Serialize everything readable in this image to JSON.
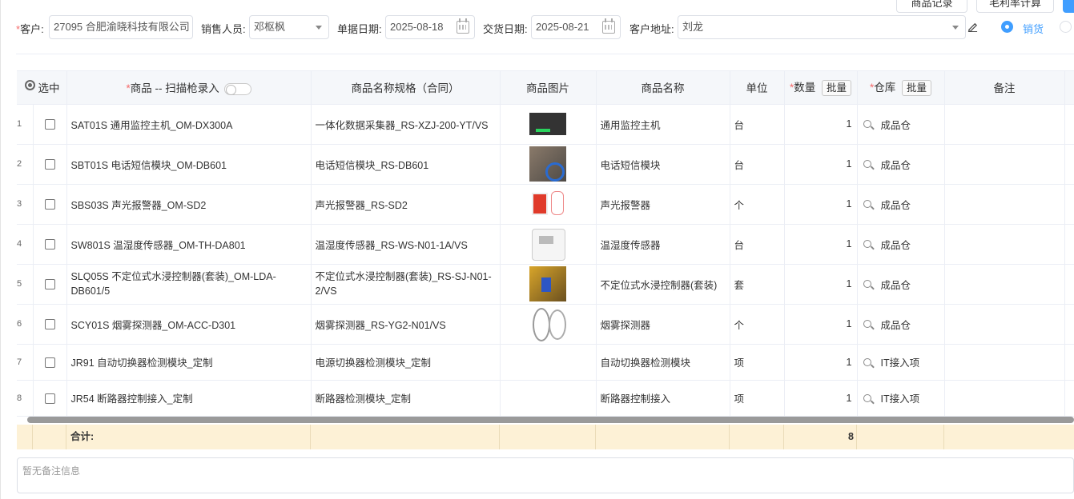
{
  "top_buttons": [
    {
      "label": "商品记录"
    },
    {
      "label": "毛利率计算"
    }
  ],
  "form": {
    "customer_label": "客户:",
    "customer_value": "27095 合肥渝晓科技有限公司",
    "salesperson_label": "销售人员:",
    "salesperson_value": "邓枢枫",
    "doc_date_label": "单据日期:",
    "doc_date_value": "2025-08-18",
    "delivery_date_label": "交货日期:",
    "delivery_date_value": "2025-08-21",
    "address_label": "客户地址:",
    "address_value": "刘龙",
    "radio_sales_label": "销货"
  },
  "table": {
    "headers": {
      "select": "选中",
      "product": "商品 -- 扫描枪录入",
      "spec": "商品名称规格（合同）",
      "image": "商品图片",
      "name": "商品名称",
      "unit": "单位",
      "qty": "数量",
      "batch": "批量",
      "warehouse": "仓库",
      "remark": "备注"
    },
    "rows": [
      {
        "idx": "1",
        "product": "SAT01S 通用监控主机_OM-DX300A",
        "spec": "一体化数据采集器_RS-XZJ-200-YT/VS",
        "image": "monitor-host",
        "name": "通用监控主机",
        "unit": "台",
        "qty": "1",
        "warehouse": "成品仓"
      },
      {
        "idx": "2",
        "product": "SBT01S 电话短信模块_OM-DB601",
        "spec": "电话短信模块_RS-DB601",
        "image": "sms-module",
        "name": "电话短信模块",
        "unit": "台",
        "qty": "1",
        "warehouse": "成品仓"
      },
      {
        "idx": "3",
        "product": "SBS03S 声光报警器_OM-SD2",
        "spec": "声光报警器_RS-SD2",
        "image": "alarm",
        "name": "声光报警器",
        "unit": "个",
        "qty": "1",
        "warehouse": "成品仓"
      },
      {
        "idx": "4",
        "product": "SW801S 温湿度传感器_OM-TH-DA801",
        "spec": "温湿度传感器_RS-WS-N01-1A/VS",
        "image": "th-sensor",
        "name": "温湿度传感器",
        "unit": "台",
        "qty": "1",
        "warehouse": "成品仓"
      },
      {
        "idx": "5",
        "product": "SLQ05S 不定位式水浸控制器(套装)_OM-LDA-DB601/5",
        "spec": "不定位式水浸控制器(套装)_RS-SJ-N01-2/VS",
        "image": "water-leak",
        "name": "不定位式水浸控制器(套装)",
        "unit": "套",
        "qty": "1",
        "warehouse": "成品仓"
      },
      {
        "idx": "6",
        "product": "SCY01S 烟雾探测器_OM-ACC-D301",
        "spec": "烟雾探测器_RS-YG2-N01/VS",
        "image": "smoke-detector",
        "name": "烟雾探测器",
        "unit": "个",
        "qty": "1",
        "warehouse": "成品仓"
      },
      {
        "idx": "7",
        "product": "JR91 自动切换器检测模块_定制",
        "spec": "电源切换器检测模块_定制",
        "image": "",
        "name": "自动切换器检测模块",
        "unit": "项",
        "qty": "1",
        "warehouse": "IT接入项"
      },
      {
        "idx": "8",
        "product": "JR54 断路器控制接入_定制",
        "spec": "断路器检测模块_定制",
        "image": "",
        "name": "断路器控制接入",
        "unit": "项",
        "qty": "1",
        "warehouse": "IT接入项"
      }
    ]
  },
  "summary": {
    "label": "合计:",
    "total_qty": "8"
  },
  "remark_placeholder": "暂无备注信息"
}
